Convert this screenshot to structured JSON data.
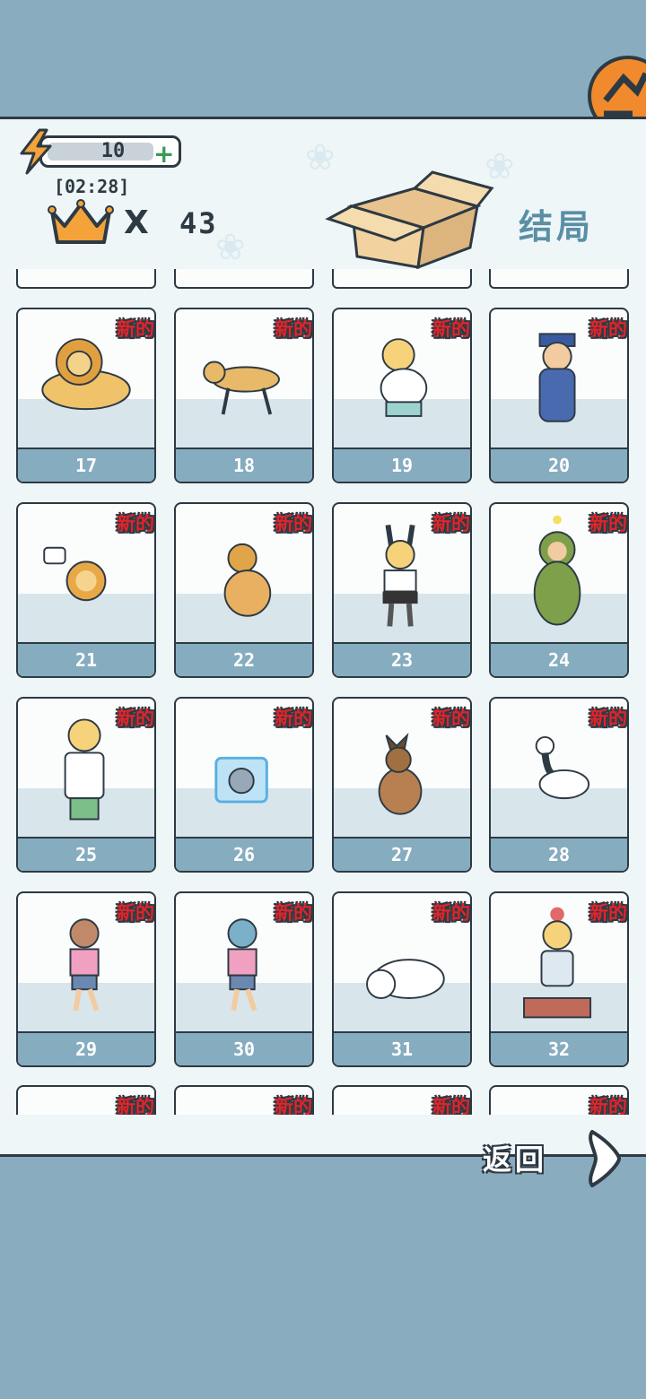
{
  "energy": {
    "count": "10",
    "plus_icon": "plus-icon"
  },
  "timer": "[02:28]",
  "crowns": {
    "times_symbol": "X",
    "count": "43"
  },
  "ending": {
    "label": "结局"
  },
  "new_tag": "新的",
  "cards": [
    {
      "num": "17",
      "art": "lion-lying"
    },
    {
      "num": "18",
      "art": "dog-walking"
    },
    {
      "num": "19",
      "art": "boy-crying"
    },
    {
      "num": "20",
      "art": "police-officer"
    },
    {
      "num": "21",
      "art": "lion-cub-confused"
    },
    {
      "num": "22",
      "art": "golden-retriever-sitting"
    },
    {
      "num": "23",
      "art": "bunny-costume-man"
    },
    {
      "num": "24",
      "art": "green-suit-man"
    },
    {
      "num": "25",
      "art": "doctor-man"
    },
    {
      "num": "26",
      "art": "cat-in-ice-cube"
    },
    {
      "num": "27",
      "art": "german-shepherd"
    },
    {
      "num": "28",
      "art": "goose-honking"
    },
    {
      "num": "29",
      "art": "woman-shocked"
    },
    {
      "num": "30",
      "art": "woman-angry"
    },
    {
      "num": "31",
      "art": "polar-bear-lying"
    },
    {
      "num": "32",
      "art": "man-in-litter-box"
    }
  ],
  "footer": {
    "return_label": "返回"
  }
}
